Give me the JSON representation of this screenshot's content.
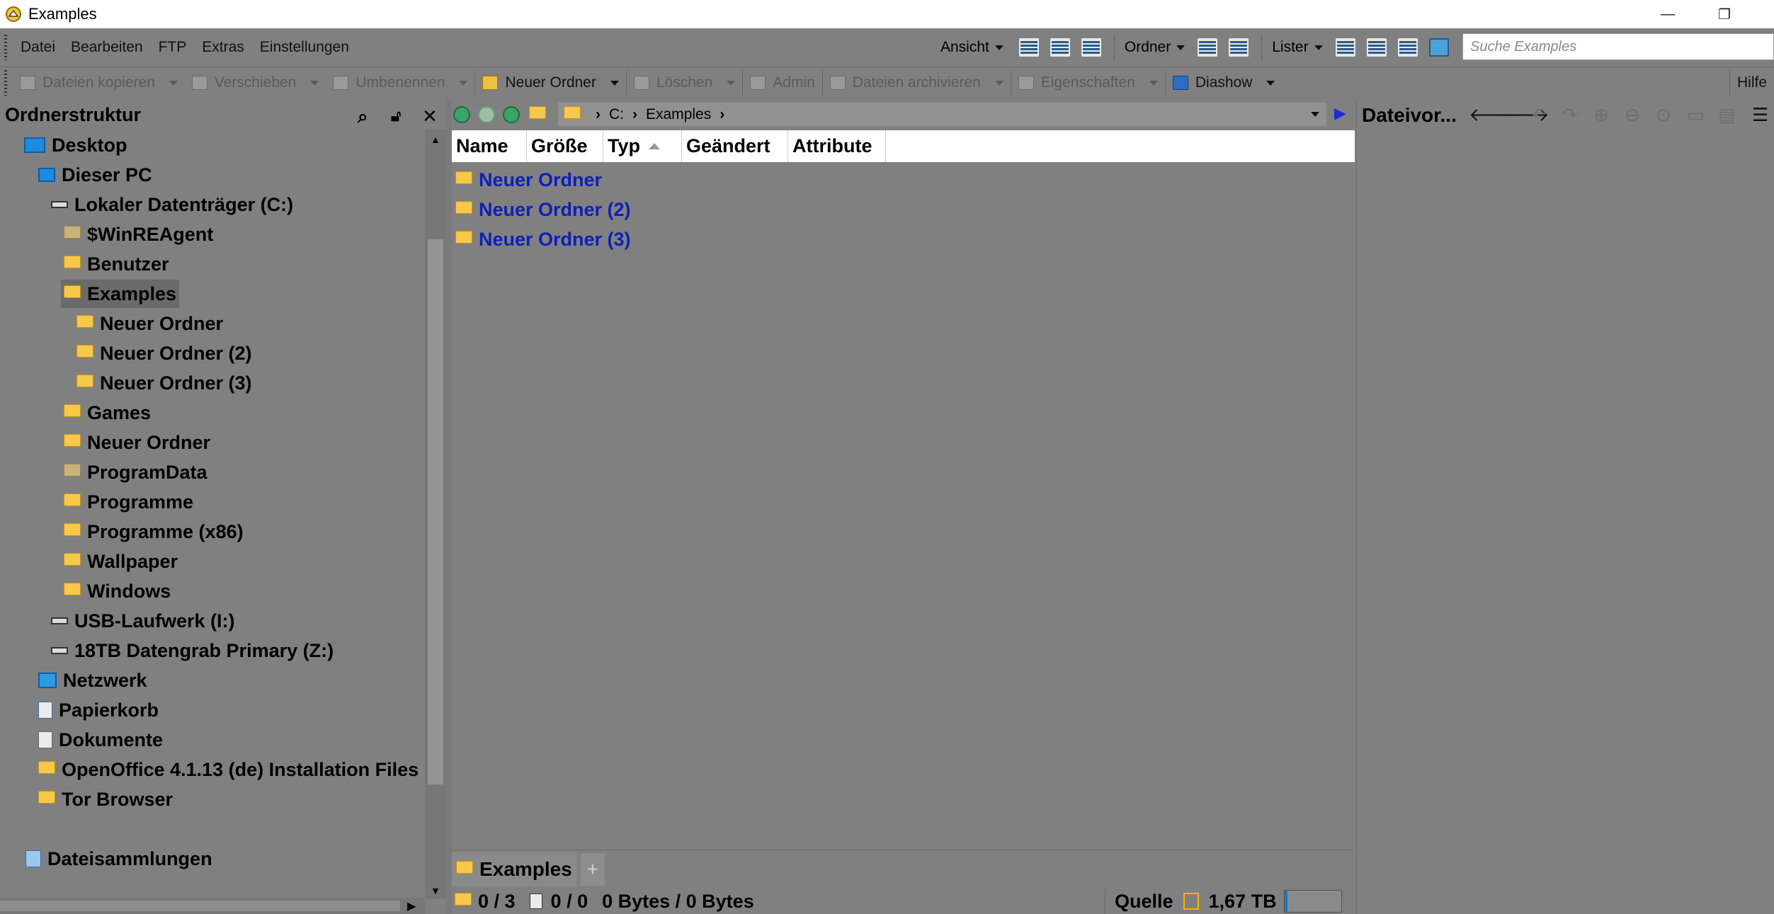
{
  "window": {
    "title": "Examples"
  },
  "menubar": {
    "items": [
      "Datei",
      "Bearbeiten",
      "FTP",
      "Extras",
      "Einstellungen"
    ],
    "ansicht": "Ansicht",
    "ordner": "Ordner",
    "lister": "Lister",
    "search_placeholder": "Suche Examples"
  },
  "toolbar": {
    "copy": "Dateien kopieren",
    "move": "Verschieben",
    "rename": "Umbenennen",
    "new_folder": "Neuer Ordner",
    "delete": "Löschen",
    "admin": "Admin",
    "archive": "Dateien archivieren",
    "properties": "Eigenschaften",
    "slideshow": "Diashow",
    "help": "Hilfe"
  },
  "left_pane": {
    "title": "Ordnerstruktur",
    "tree": [
      {
        "label": "Desktop",
        "icon": "desktop-icon"
      },
      {
        "label": "Dieser PC",
        "icon": "pc-icon"
      },
      {
        "label": "Lokaler Datenträger (C:)",
        "icon": "drive-icon"
      },
      {
        "label": "$WinREAgent",
        "icon": "folder-icon"
      },
      {
        "label": "Benutzer",
        "icon": "folder-icon"
      },
      {
        "label": "Examples",
        "icon": "folder-icon",
        "selected": true
      },
      {
        "label": "Neuer Ordner",
        "icon": "folder-icon"
      },
      {
        "label": "Neuer Ordner (2)",
        "icon": "folder-icon"
      },
      {
        "label": "Neuer Ordner (3)",
        "icon": "folder-icon"
      },
      {
        "label": "Games",
        "icon": "folder-icon"
      },
      {
        "label": "Neuer Ordner",
        "icon": "folder-icon"
      },
      {
        "label": "ProgramData",
        "icon": "folder-icon"
      },
      {
        "label": "Programme",
        "icon": "folder-icon"
      },
      {
        "label": "Programme (x86)",
        "icon": "folder-icon"
      },
      {
        "label": "Wallpaper",
        "icon": "folder-icon"
      },
      {
        "label": "Windows",
        "icon": "folder-icon"
      },
      {
        "label": "USB-Laufwerk (I:)",
        "icon": "drive-icon"
      },
      {
        "label": "18TB Datengrab Primary (Z:)",
        "icon": "drive-icon"
      },
      {
        "label": "Netzwerk",
        "icon": "network-icon"
      },
      {
        "label": "Papierkorb",
        "icon": "recycle-bin-icon"
      },
      {
        "label": "Dokumente",
        "icon": "documents-icon"
      },
      {
        "label": "OpenOffice 4.1.13 (de) Installation Files",
        "icon": "folder-icon"
      },
      {
        "label": "Tor Browser",
        "icon": "folder-icon"
      },
      {
        "label": "Dateisammlungen",
        "icon": "collections-icon"
      }
    ]
  },
  "path": {
    "drive": "C:",
    "folder": "Examples"
  },
  "file_list": {
    "columns": [
      "Name",
      "Größe",
      "Typ",
      "Geändert",
      "Attribute"
    ],
    "sort_column": "Typ",
    "rows": [
      "Neuer Ordner",
      "Neuer Ordner (2)",
      "Neuer Ordner (3)"
    ]
  },
  "tab": {
    "label": "Examples",
    "add": "+"
  },
  "status": {
    "folders": "0 / 3",
    "files": "0 / 0",
    "bytes": "0 Bytes / 0 Bytes",
    "source": "Quelle",
    "free": "1,67 TB",
    "usage_fraction": 0.05
  },
  "right_pane": {
    "title": "Dateivor..."
  }
}
